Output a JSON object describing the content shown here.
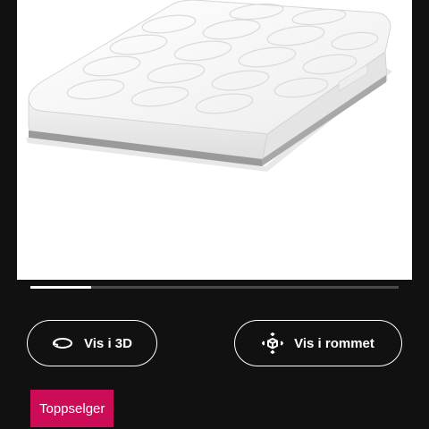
{
  "product": {
    "image_alt": "Hvit barnemadrass"
  },
  "carousel": {
    "current_index": 1,
    "total_images": 5,
    "progress_fraction": 0.165
  },
  "actions": {
    "view_3d_label": "Vis i 3D",
    "view_3d_icon": "rotate-3d-icon",
    "view_room_label": "Vis i rommet",
    "view_room_icon": "augmented-reality-icon"
  },
  "badge": {
    "label": "Toppselger",
    "color": "#cc0c56"
  },
  "theme": {
    "background": "#111111",
    "image_background": "#ffffff",
    "button_border": "#ffffff",
    "text": "#ffffff"
  }
}
